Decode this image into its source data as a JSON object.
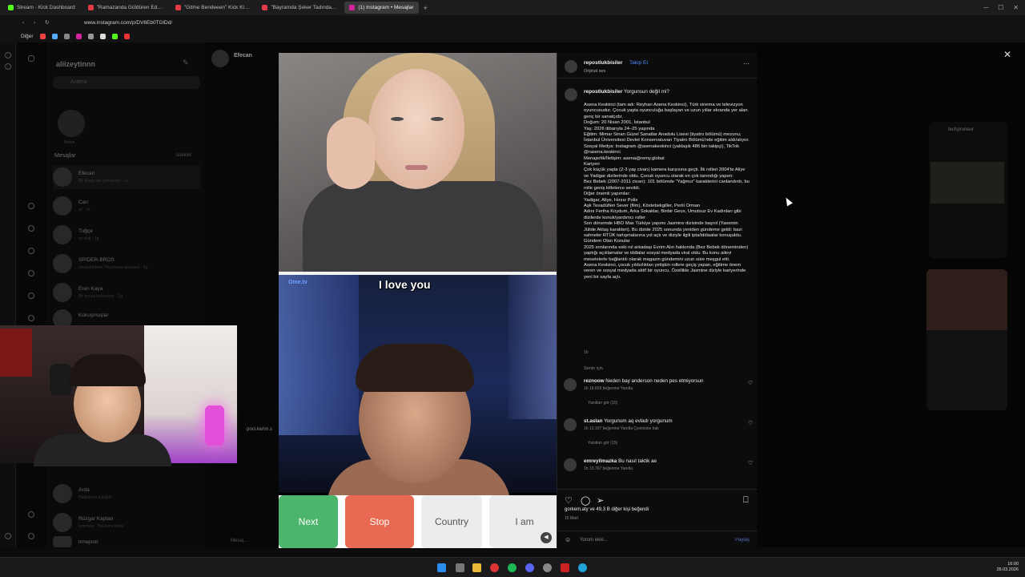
{
  "browser": {
    "tabs": [
      {
        "label": "Stream - Kick Dashboard",
        "color": "#53fc18",
        "active": false
      },
      {
        "label": "\"Ramazanda Güldüren Ed…",
        "color": "#e63946",
        "active": false
      },
      {
        "label": "\"Gitme Bendeeen\" Kick Kl…",
        "color": "#e63946",
        "active": false
      },
      {
        "label": "\"Bayramda Şeker Tadında…",
        "color": "#e63946",
        "active": false
      },
      {
        "label": "(1) Instagram • Mesajlar",
        "color": "#d6249f",
        "active": true
      }
    ],
    "url": "www.instagram.com/p/DV6Eb0TGlDd/",
    "bookmark_label": "Diğer"
  },
  "instagram": {
    "username": "aliizeytinnn",
    "search_placeholder": "Arama",
    "messages_label": "Mesajlar",
    "requests_label": "İstekler",
    "note_label": "Notun",
    "chat_name": "Efecan",
    "conversations": [
      {
        "name": "Efecan",
        "sub": "Bir dosya eki gönderdin · 1s"
      },
      {
        "name": "Can",
        "sub": "ali · 1s"
      },
      {
        "name": "Tuğçe",
        "sub": "ye sildi · 1g"
      },
      {
        "name": "SPIDER-BROS",
        "sub": "ebrukumdemi: Haydaaaa gelsssss · 2g"
      },
      {
        "name": "Eren Kaya",
        "sub": "Bir mesaj bekleniyor · 2g"
      },
      {
        "name": "Kokuşmuşlar",
        "sub": "…"
      },
      {
        "name": "Arda",
        "sub": "Hallediveri inşallah"
      },
      {
        "name": "Rüzgar Kaptan",
        "sub": "mmmww · Bekleme bekle"
      },
      {
        "name": "mrwpolo",
        "sub": "…"
      }
    ],
    "message_placeholder": "Mesaj…"
  },
  "video": {
    "logo": "Ome.tv",
    "caption": "I love you",
    "buttons": {
      "next": "Next",
      "stop": "Stop",
      "country": "Country",
      "iam": "I am"
    }
  },
  "post": {
    "author": "repostlukbisiler",
    "follow": "Takip Et",
    "audio": "Orijinal ses",
    "caption_title": "Yorgunsun değil mi?",
    "caption_body": "Asena Keskinci (tam adı: Reyhan Asena Keskinci), Türk sinema ve televizyon oyuncusudur. Çocuk yaşta oyunculuğa başlayan ve uzun yıllar ekranda yer alan genç bir sanatçıdır.\nDoğum: 20 Nisan 2001, İstanbul\nYaş: 2026 itibarıyla 24–25 yaşında\nEğitim: Mimar Sinan Güzel Sanatlar Anadolu Lisesi (tiyatro bölümü) mezunu; İstanbul Üniversitesi Devlet Konservatuvarı Tiyatro Bölümü'nde eğitim aldı/alıyor.\nSosyal Medya: Instagram @asenakeskinci (yaklaşık 486 bin takipçi), TikTok @rasena.keskinci\nMenajerlik/İletişim: asena@remy.global\nKariyeri\nÇok küçük yaşta (2-3 yaş civarı) kamera karşısına geçti. İlk rolleri 2004'te Aliye ve Yadigar dizilerinde oldu. Çocuk oyuncu olarak en çok tanındığı yapım:\nBez Bebek (2007-2011 civarı): 101 bölümde \"Yağmur\" karakterini canlandırdı, bu rolle geniş kitlelerce sevildi.\nDiğer önemli yapımlar:\nYadigar, Aliye, Hırsız Polis\nAşk Tesadüfleri Sever (film), Köstebekgiller, Perili Orman\nAdını Feriha Koydum, Arka Sokaklar, Binbir Gece, Umutsuz Ev Kadınları gibi dizilerde konuk/yardımcı roller\nSon dönemde HBO Max Türkiye yapımı Jasmine dizisinde başrol (Yasemin Jülide Aktaş karakteri). Bu dizide 2025 sonunda yeniden gündeme geldi: bazı sahneler RTÜK tartışmalarına yol açtı ve diziyle ilgili ipta/iddiaalar konuşuldu.\nGündem Olan Konular\n2025 sonlarında eski rol arkadaşı Evrim Alın hakkında (Bez Bebek döneminden) yaptığı açıklamalar ve iddialar sosyal medyada viral oldu. Bu konu ailevi meselelerle bağlantılı olarak magazin gündemini uzun süre meşgul etti.\nAsena Keskinci, çocuk yıldızlıktan yetişkin rollere geçiş yapan, eğitime önem veren ve sosyal medyada aktif bir oyuncu. Özellikle Jasmine diziyle kariyerinde yeni bir sayfa açtı.",
    "caption_time": "1h",
    "for_you": "Senin için",
    "comments": [
      {
        "user": "reznoow",
        "text": "Neden bay anderson neden pes etmiyorsun",
        "meta": "1h   16.609 beğenme   Yanıtla",
        "replies": "Yanıtları gör (10)"
      },
      {
        "user": "st.aslan",
        "text": "Yorgunum aq evladı yorgunum",
        "meta": "1h   13.107 beğenme   Yanıtla   Çevirisine bak",
        "replies": "Yanıtları gör (15)"
      },
      {
        "user": "emreyilmazka",
        "text": "Bu nasıl taktik ae",
        "meta": "1h   10.767 beğenme   Yanıtla",
        "replies": ""
      }
    ],
    "likes": "gorkem.aty ve 49,3 B diğer kişi beğendi",
    "date": "15 Mart",
    "add_comment": "Yorum ekle...",
    "share": "Paylaş"
  },
  "side": {
    "pip_title": "techpruneur"
  },
  "webcam": {
    "overlay": "poci.kerim.s"
  },
  "taskbar": {
    "time": "16:00",
    "date": "28.03.2026"
  }
}
